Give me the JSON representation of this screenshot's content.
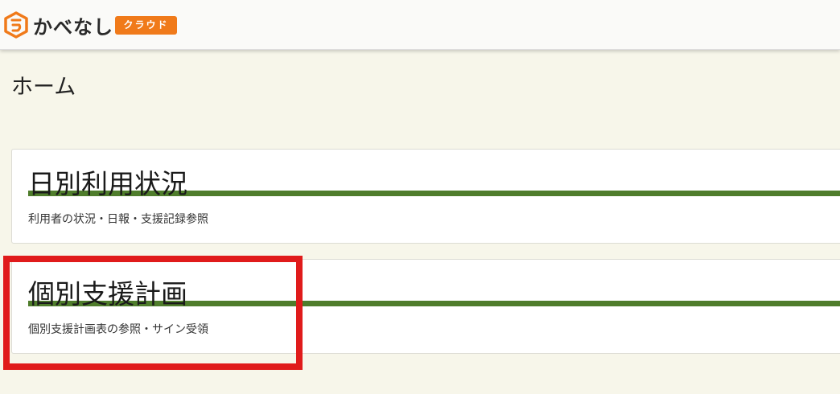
{
  "header": {
    "app_name": "かべなし",
    "badge": "クラウド",
    "logo_color": "#f07a1a"
  },
  "page": {
    "title": "ホーム"
  },
  "menu": [
    {
      "title": "日別利用状況",
      "description": "利用者の状況・日報・支援記録参照"
    },
    {
      "title": "個別支援計画",
      "description": "個別支援計画表の参照・サイン受領"
    }
  ],
  "colors": {
    "background": "#f7f6ea",
    "accent_underline": "#4f7d2c",
    "highlight": "#e01b1b"
  }
}
